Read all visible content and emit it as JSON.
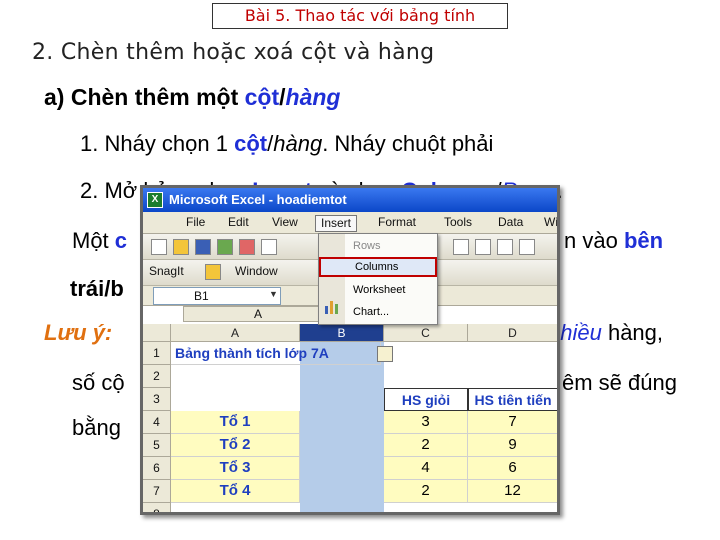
{
  "slide": {
    "title": "Bài 5. Thao tác với bảng tính",
    "section": "2. Chèn thêm hoặc xoá cột và hàng",
    "subheading": {
      "prefix": "a) Chèn thêm một ",
      "col": "cột",
      "slash": "/",
      "row": "hàng"
    },
    "step1": {
      "text": "1. Nháy chọn 1 ",
      "col": "cột",
      "slash": "/",
      "row": "hàng",
      "after": ". Nháy chuột phải"
    },
    "step2": {
      "text": "2. Mở bảng chọn ",
      "insert": "Insert",
      "mid": " và chọn ",
      "columns": "Columns",
      "slash": "/",
      "rows": "Rows",
      "end": "."
    },
    "line3": {
      "left": "Một ",
      "left_bold": "c",
      "right_text": "n vào ",
      "right_bold": "bên"
    },
    "line4": {
      "bold": "trái/b"
    },
    "note": {
      "label": "Lưu ý:",
      "right_italic": "nhiều",
      "right_text": " hàng,"
    },
    "line6": {
      "left": "số cộ",
      "right": "êm sẽ đúng"
    },
    "line7": {
      "left": "bằng"
    }
  },
  "excel": {
    "title": "Microsoft Excel - hoadiemtot",
    "menus": [
      "File",
      "Edit",
      "View",
      "Insert",
      "Format",
      "Tools",
      "Data",
      "Wi"
    ],
    "active_menu": "Insert",
    "snagit": "SnagIt",
    "window": "Window",
    "namebox": "B1",
    "small_col": "A",
    "dropdown": [
      "Rows",
      "Columns",
      "Worksheet",
      "Chart..."
    ],
    "dropdown_selected": "Columns",
    "columns": [
      "A",
      "B",
      "C",
      "D"
    ],
    "rows": [
      "1",
      "2",
      "3",
      "4",
      "5",
      "6",
      "7",
      "8"
    ],
    "cells": {
      "a1": "Bảng thành tích lớp 7A",
      "c3": "HS giỏi",
      "d3": "HS tiên tiến",
      "a4": "Tổ 1",
      "a5": "Tổ 2",
      "a6": "Tổ 3",
      "a7": "Tổ 4",
      "c4": "3",
      "c5": "2",
      "c6": "4",
      "c7": "2",
      "d4": "7",
      "d5": "9",
      "d6": "6",
      "d7": "12"
    }
  },
  "colors": {
    "title": "#c00000",
    "accent_blue": "#1f2fd6",
    "note_orange": "#e07010",
    "selected_column": "#1f3f8f"
  }
}
